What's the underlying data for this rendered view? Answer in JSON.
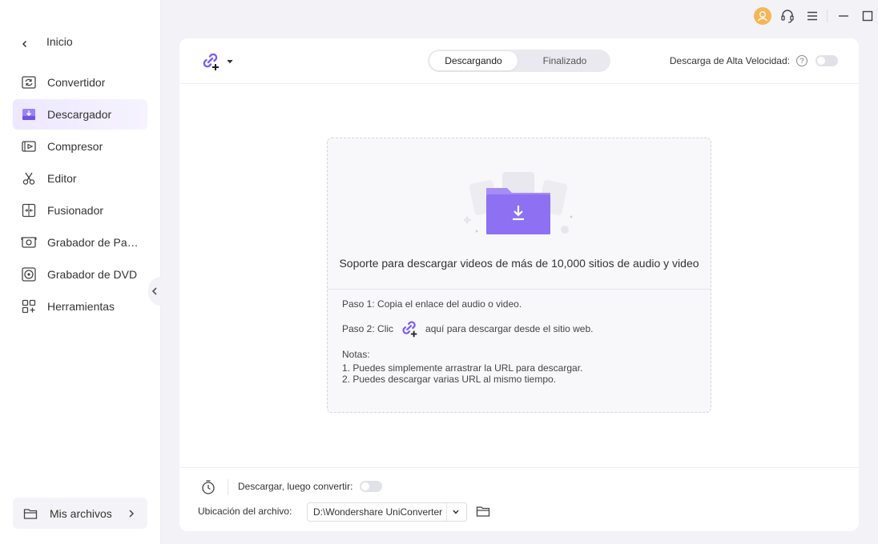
{
  "sidebar": {
    "home_label": "Inicio",
    "items": [
      {
        "label": "Convertidor",
        "icon": "convert-icon"
      },
      {
        "label": "Descargador",
        "icon": "download-icon"
      },
      {
        "label": "Compresor",
        "icon": "compress-icon"
      },
      {
        "label": "Editor",
        "icon": "scissors-icon"
      },
      {
        "label": "Fusionador",
        "icon": "merge-icon"
      },
      {
        "label": "Grabador de Pan...",
        "icon": "screen-record-icon"
      },
      {
        "label": "Grabador de DVD",
        "icon": "dvd-icon"
      },
      {
        "label": "Herramientas",
        "icon": "grid-icon"
      }
    ],
    "active_index": 1,
    "files_label": "Mis archivos"
  },
  "header": {
    "tabs": [
      "Descargando",
      "Finalizado"
    ],
    "active_tab": "Descargando",
    "high_speed_label": "Descarga de Alta Velocidad:",
    "help_glyph": "?"
  },
  "dropzone": {
    "title": "Soporte para descargar videos de más de 10,000 sitios de audio y video",
    "step1": "Paso 1: Copia el enlace del audio o video.",
    "step2_prefix": "Paso 2: Clic",
    "step2_suffix": "aquí para descargar desde el sitio web.",
    "notes_title": "Notas:",
    "notes": [
      "1. Puedes simplemente arrastrar la URL para descargar.",
      "2. Puedes descargar varias URL al mismo tiempo."
    ]
  },
  "footer": {
    "download_convert_label": "Descargar, luego convertir:",
    "location_label": "Ubicación del archivo:",
    "location_value": "D:\\Wondershare UniConverter"
  },
  "toggles": {
    "high_speed": false,
    "download_then_convert": false
  },
  "colors": {
    "accent": "#7b5cf5",
    "active_nav": "#ede8ff",
    "user_avatar": "#f5b656"
  }
}
